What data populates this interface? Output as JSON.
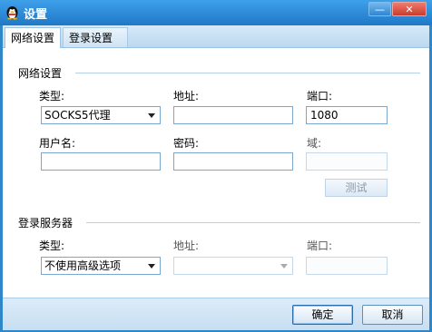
{
  "window": {
    "title": "设置",
    "minimize_label": "—",
    "close_label": "✕"
  },
  "tabs": [
    {
      "label": "网络设置",
      "active": true
    },
    {
      "label": "登录设置",
      "active": false
    }
  ],
  "network": {
    "section_title": "网络设置",
    "type_label": "类型:",
    "type_value": "SOCKS5代理",
    "address_label": "地址:",
    "address_value": "",
    "port_label": "端口:",
    "port_value": "1080",
    "username_label": "用户名:",
    "username_value": "",
    "password_label": "密码:",
    "password_value": "",
    "domain_label": "域:",
    "domain_value": "",
    "test_button": "测试"
  },
  "login_server": {
    "section_title": "登录服务器",
    "type_label": "类型:",
    "type_value": "不使用高级选项",
    "address_label": "地址:",
    "address_value": "",
    "port_label": "端口:",
    "port_value": ""
  },
  "footer": {
    "ok_label": "确定",
    "cancel_label": "取消"
  }
}
